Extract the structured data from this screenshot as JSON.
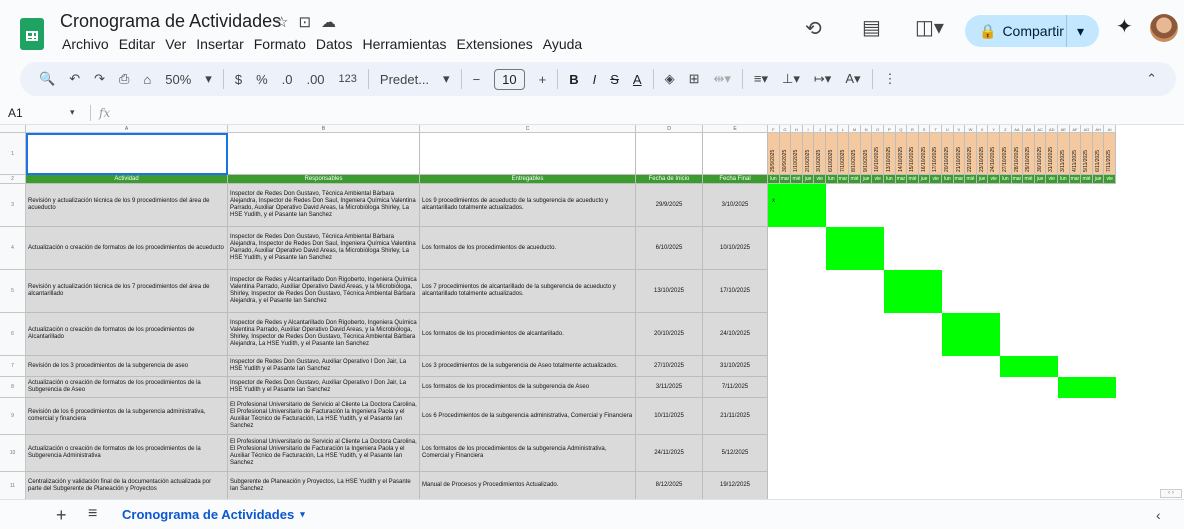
{
  "app": {
    "doc_title": "Cronograma de Actividades"
  },
  "menu": [
    "Archivo",
    "Editar",
    "Ver",
    "Insertar",
    "Formato",
    "Datos",
    "Herramientas",
    "Extensiones",
    "Ayuda"
  ],
  "share": {
    "label": "Compartir"
  },
  "toolbar": {
    "zoom": "50%",
    "currency": "$",
    "percent": "%",
    "dec_less": ".0",
    "dec_more": ".00",
    "num_format": "123",
    "font": "Predet...",
    "font_size": "10",
    "bold": "B",
    "italic": "I",
    "strike": "S",
    "text_color": "A"
  },
  "formula_bar": {
    "cell_ref": "A1",
    "fx": "fx",
    "value": ""
  },
  "columns": {
    "letters": [
      "A",
      "B",
      "C",
      "D",
      "E"
    ],
    "date_letters": [
      "F",
      "G",
      "H",
      "I",
      "J",
      "K",
      "L",
      "M",
      "N",
      "O",
      "P",
      "Q",
      "R",
      "S",
      "T",
      "U",
      "V",
      "W",
      "X",
      "Y",
      "Z",
      "AA",
      "AB",
      "AC",
      "AD",
      "AE",
      "AF",
      "AG",
      "AH",
      "AI"
    ]
  },
  "headers": [
    "Actividad",
    "Responsables",
    "Entregables",
    "Fecha de Inicio",
    "Fecha Final"
  ],
  "dates": [
    "29/9/2025",
    "30/9/2025",
    "1/10/2025",
    "2/10/2025",
    "3/10/2025",
    "6/10/2025",
    "7/10/2025",
    "8/10/2025",
    "9/10/2025",
    "10/10/2025",
    "13/10/2025",
    "14/10/2025",
    "15/10/2025",
    "16/10/2025",
    "17/10/2025",
    "20/10/2025",
    "21/10/2025",
    "22/10/2025",
    "23/10/2025",
    "24/10/2025",
    "27/10/2025",
    "28/10/2025",
    "29/10/2025",
    "30/10/2025",
    "31/10/2025",
    "3/11/2025",
    "4/11/2025",
    "5/11/2025",
    "6/11/2025",
    "7/11/2025"
  ],
  "weekdays": [
    "lun",
    "mar",
    "mié",
    "jue",
    "vie",
    "lun",
    "mar",
    "mié",
    "jue",
    "vie",
    "lun",
    "mar",
    "mié",
    "jue",
    "vie",
    "lun",
    "mar",
    "mié",
    "jue",
    "vie",
    "lun",
    "mar",
    "mié",
    "jue",
    "vie",
    "lun",
    "mar",
    "mié",
    "jue",
    "vie"
  ],
  "rows": [
    {
      "n": "3",
      "act": "Revisión y actualización técnica de los 9 procedimientos del área de acueducto",
      "resp": "Inspector de Redes Don Gustavo, Técnica Ambiental Bárbara Alejandra, Inspector de Redes Don Saul, Ingeniera Química Valentina Parrado, Auxiliar Operativo David Areas, la Microbióloga Shirley, La HSE Yudith, y el Pasante Ian Sanchez",
      "ent": "Los 9 procedimientos de acueducto de la subgerencia de acueducto y alcantarillado totalmente actualizados.",
      "ini": "29/9/2025",
      "fin": "3/10/2025"
    },
    {
      "n": "4",
      "act": "Actualización o creación de formatos de los procedimientos de acueducto",
      "resp": "Inspector de Redes Don Gustavo, Técnica Ambiental Bárbara Alejandra, Inspector de Redes Don Saul, Ingeniera Química Valentina Parrado, Auxiliar Operativo David Areas, la Microbióloga Shirley, La HSE Yudith, y el Pasante Ian Sanchez",
      "ent": "Los formatos de los procedimientos de acueducto.",
      "ini": "6/10/2025",
      "fin": "10/10/2025"
    },
    {
      "n": "5",
      "act": "Revisión y actualización técnica de los 7 procedimientos del área de alcantarillado",
      "resp": "Inspector de Redes y Alcantarillado Don Rigoberto, Ingeniera Química Valentina Parrado, Auxiliar Operativo David Areas, y la Microbióloga, Shirley, Inspector de Redes Don Gustavo, Técnica Ambiental Bárbara Alejandra, y el Pasante Ian Sanchez",
      "ent": "Los 7 procedimientos de alcantarillado de la subgerencia de acueducto y alcantarillado totalmente actualizados.",
      "ini": "13/10/2025",
      "fin": "17/10/2025"
    },
    {
      "n": "6",
      "act": "Actualización o creación de formatos de los procedimientos de Alcantarillado",
      "resp": "Inspector de Redes y Alcantarillado Don Rigoberto, Ingeniera Química Valentina Parrado, Auxiliar Operativo David Areas, y la Microbióloga, Shirley, Inspector de Redes Don Gustavo, Técnica Ambiental Bárbara Alejandra, La HSE Yudith, y el Pasante Ian Sanchez",
      "ent": "Los formatos de los procedimientos de alcantarillado.",
      "ini": "20/10/2025",
      "fin": "24/10/2025"
    },
    {
      "n": "7",
      "act": "Revisión de los 3 procedimientos de la subgerencia de aseo",
      "resp": "Inspector de Redes Don Gustavo, Auxiliar Operativo I Don Jair, La HSE Yudith y el Pasante Ian Sanchez",
      "ent": "Los 3 procedimientos de la subgerencia de Aseo totalmente actualizados.",
      "ini": "27/10/2025",
      "fin": "31/10/2025"
    },
    {
      "n": "8",
      "act": "Actualización o creación de formatos de los procedimientos de la Subgerencia de Aseo",
      "resp": "Inspector de Redes Don Gustavo, Auxiliar Operativo I Don Jair, La HSE Yudith y el Pasante Ian Sanchez",
      "ent": "Los formatos de los procedimientos de la subgerencia de Aseo",
      "ini": "3/11/2025",
      "fin": "7/11/2025"
    },
    {
      "n": "9",
      "act": "Revisión de los 6 procedimientos de la subgerencia administrativa, comercial y financiera",
      "resp": "El Profesional Universitario de Servicio al Cliente La Doctora Carolina, El Profesional Universitario de Facturación la Ingeniera Paola y el Auxiliar Técnico de Facturación, La HSE Yudith, y el Pasante Ian Sanchez",
      "ent": "Los 6 Procedimientos de la subgerencia administrativa, Comercial y Financiera",
      "ini": "10/11/2025",
      "fin": "21/11/2025"
    },
    {
      "n": "10",
      "act": "Actualización o creación de formatos de los procedimientos de la Subgerencia Administrativa",
      "resp": "El Profesional Universitario de Servicio al Cliente La Doctora Carolina, El Profesional Universitario de Facturación la Ingeniera Paola y el Auxiliar Técnico de Facturación, La HSE Yudith, y el Pasante Ian Sanchez",
      "ent": "Los formatos de los procedimientos de la subgerencia Administrativa, Comercial y Financiera",
      "ini": "24/11/2025",
      "fin": "5/12/2025"
    },
    {
      "n": "11",
      "act": "Centralización y validación final de la documentación actualizada por parte del Subgerente de Planeación y Proyectos",
      "resp": "Subgerente de Planeación y Proyectos, La HSE Yudith y el Pasante Ian Sanchez",
      "ent": "Manual de Procesos y Procedimientos Actualizado.",
      "ini": "8/12/2025",
      "fin": "19/12/2025"
    }
  ],
  "gantt_mark": "x",
  "sheet_tab": "Cronograma de Actividades",
  "colors": {
    "green": "#00ff00",
    "header_green": "#3a9b2e",
    "date_header": "#f4c9a0",
    "share": "#c2e7ff"
  }
}
